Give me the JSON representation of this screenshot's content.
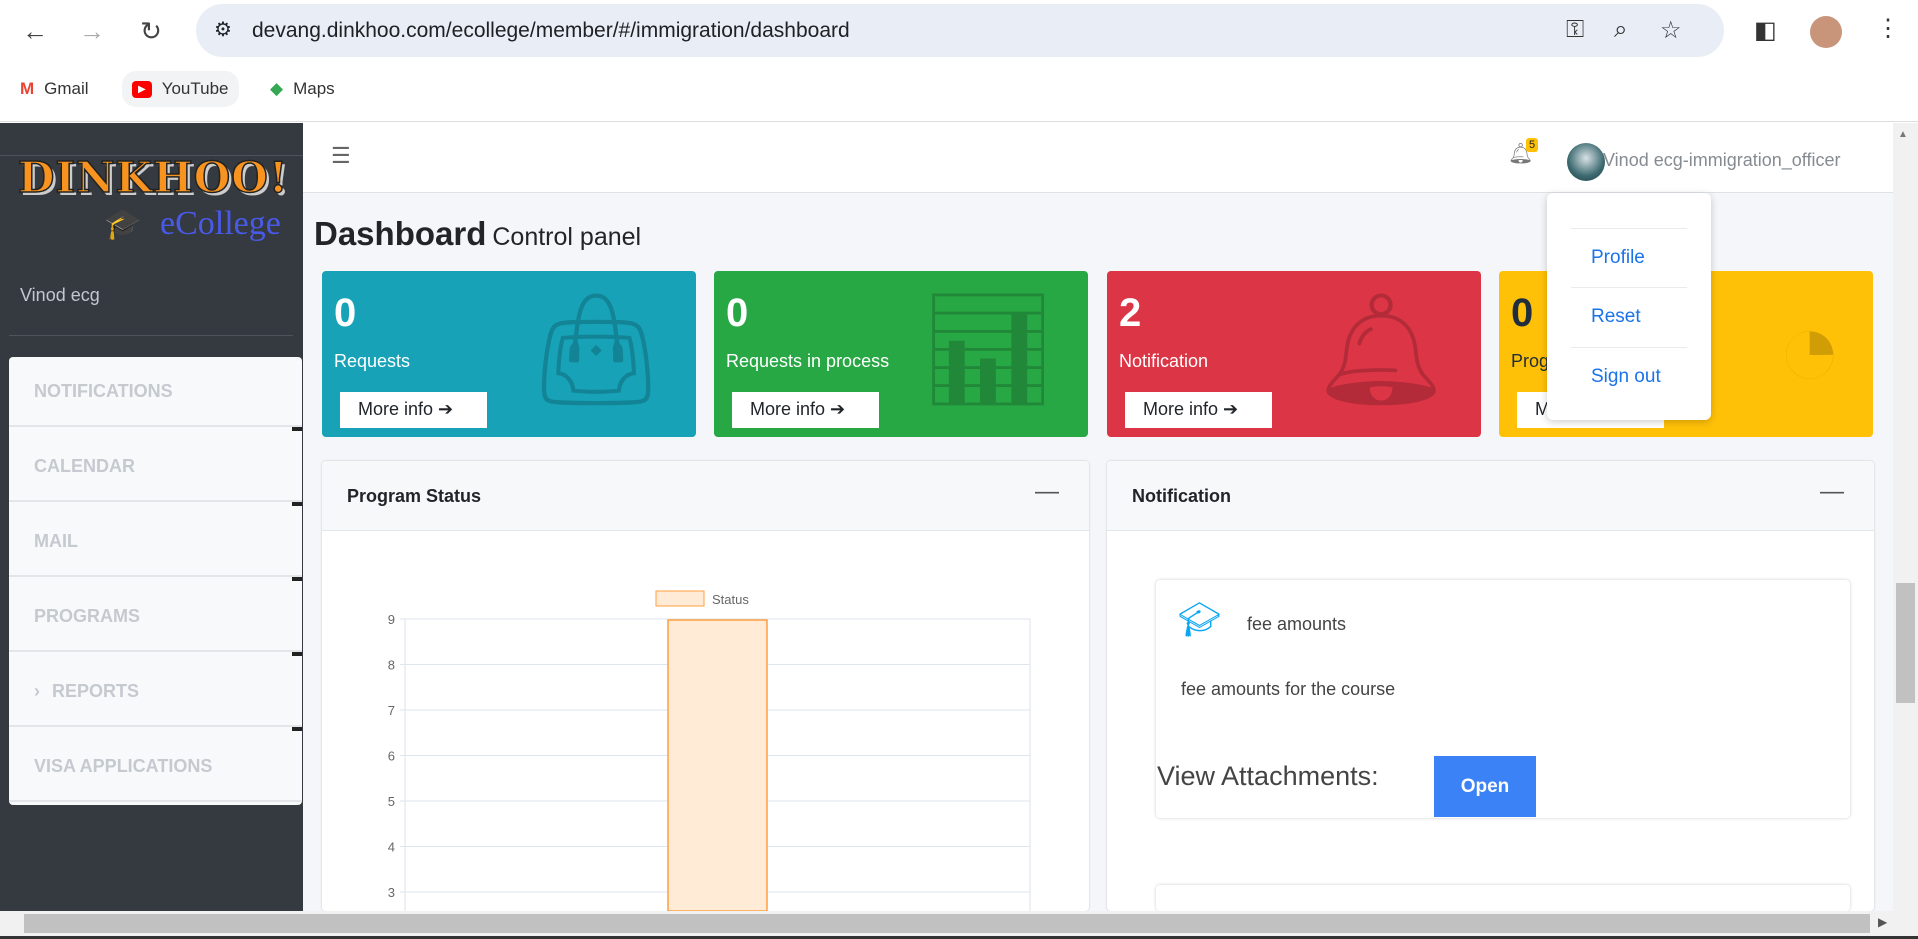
{
  "browser": {
    "url": "devang.dinkhoo.com/ecollege/member/#/immigration/dashboard",
    "bookmarks": [
      {
        "label": "Gmail"
      },
      {
        "label": "YouTube"
      },
      {
        "label": "Maps"
      }
    ]
  },
  "sidebar": {
    "logo_text": "DINKHOO!",
    "logo_sub": "eCollege",
    "user": "Vinod ecg",
    "items": [
      {
        "label": "NOTIFICATIONS"
      },
      {
        "label": "CALENDAR"
      },
      {
        "label": "MAIL"
      },
      {
        "label": "PROGRAMS"
      },
      {
        "label": "REPORTS"
      },
      {
        "label": "VISA APPLICATIONS"
      }
    ]
  },
  "topnav": {
    "badge": "5",
    "user": "Vinod ecg-immigration_officer"
  },
  "dropdown": {
    "items": [
      {
        "label": "Profile"
      },
      {
        "label": "Reset"
      },
      {
        "label": "Sign out"
      }
    ]
  },
  "page": {
    "title": "Dashboard",
    "subtitle": "Control panel"
  },
  "boxes": [
    {
      "value": "0",
      "label": "Requests",
      "more": "More info",
      "color": "#17a2b8"
    },
    {
      "value": "0",
      "label": "Requests in process",
      "more": "More info",
      "color": "#28a745"
    },
    {
      "value": "2",
      "label": "Notification",
      "more": "More info",
      "color": "#dc3545"
    },
    {
      "value": "0",
      "label": "Programs",
      "more": "More info",
      "color": "#ffc107"
    }
  ],
  "program_card": {
    "title": "Program Status"
  },
  "notification_card": {
    "title": "Notification",
    "items": [
      {
        "title": "fee amounts",
        "body": "fee amounts for the course",
        "attach_label": "View Attachments:",
        "open": "Open"
      }
    ]
  },
  "chart_data": {
    "type": "bar",
    "series": [
      {
        "name": "Status",
        "values": [
          9
        ]
      }
    ],
    "yticks": [
      "9",
      "8",
      "7",
      "6",
      "5",
      "4",
      "3"
    ],
    "ylim": [
      0,
      9
    ],
    "legend": "top",
    "grid": true,
    "color": "#ff9f40"
  }
}
